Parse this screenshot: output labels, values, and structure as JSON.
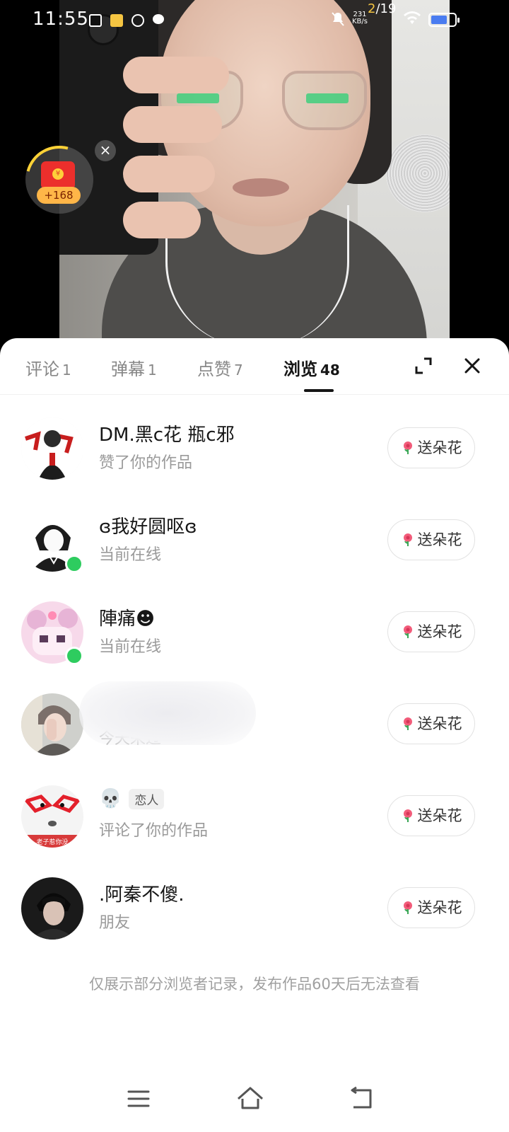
{
  "status_bar": {
    "time": "11:55",
    "counter_current": "2",
    "counter_total": "/19",
    "net_speed_value": "231",
    "net_speed_unit": "KB/s",
    "battery_level": 0.7
  },
  "red_packet": {
    "amount": "+168",
    "coin_symbol": "¥",
    "close_symbol": "×"
  },
  "tabs": [
    {
      "label": "评论",
      "count": "1"
    },
    {
      "label": "弹幕",
      "count": "1"
    },
    {
      "label": "点赞",
      "count": "7"
    },
    {
      "label": "浏览",
      "count": "48"
    }
  ],
  "active_tab": "浏览",
  "list": [
    {
      "name": "DM.黑c花 瓶c邪",
      "subtitle": "赞了你的作品",
      "button": "送朵花",
      "online": false
    },
    {
      "name": "ɞ我好圆呕ɞ",
      "subtitle": "当前在线",
      "button": "送朵花",
      "online": true
    },
    {
      "name": "陣痛☻",
      "subtitle": "当前在线",
      "button": "送朵花",
      "online": true
    },
    {
      "name": "",
      "subtitle": "今天来过",
      "button": "送朵花",
      "online": false
    },
    {
      "name": "💀",
      "tag": "恋人",
      "subtitle": "评论了你的作品",
      "button": "送朵花",
      "online": false
    },
    {
      "name": ".阿秦不傻.",
      "subtitle": "朋友",
      "button": "送朵花",
      "online": false
    }
  ],
  "footer_note": "仅展示部分浏览者记录，发布作品60天后无法查看",
  "colors": {
    "online": "#2ecc5f",
    "text_primary": "#161616",
    "text_secondary": "#9a9a9a",
    "red_packet": "#ec2f2c",
    "battery": "#4a7cf0"
  }
}
